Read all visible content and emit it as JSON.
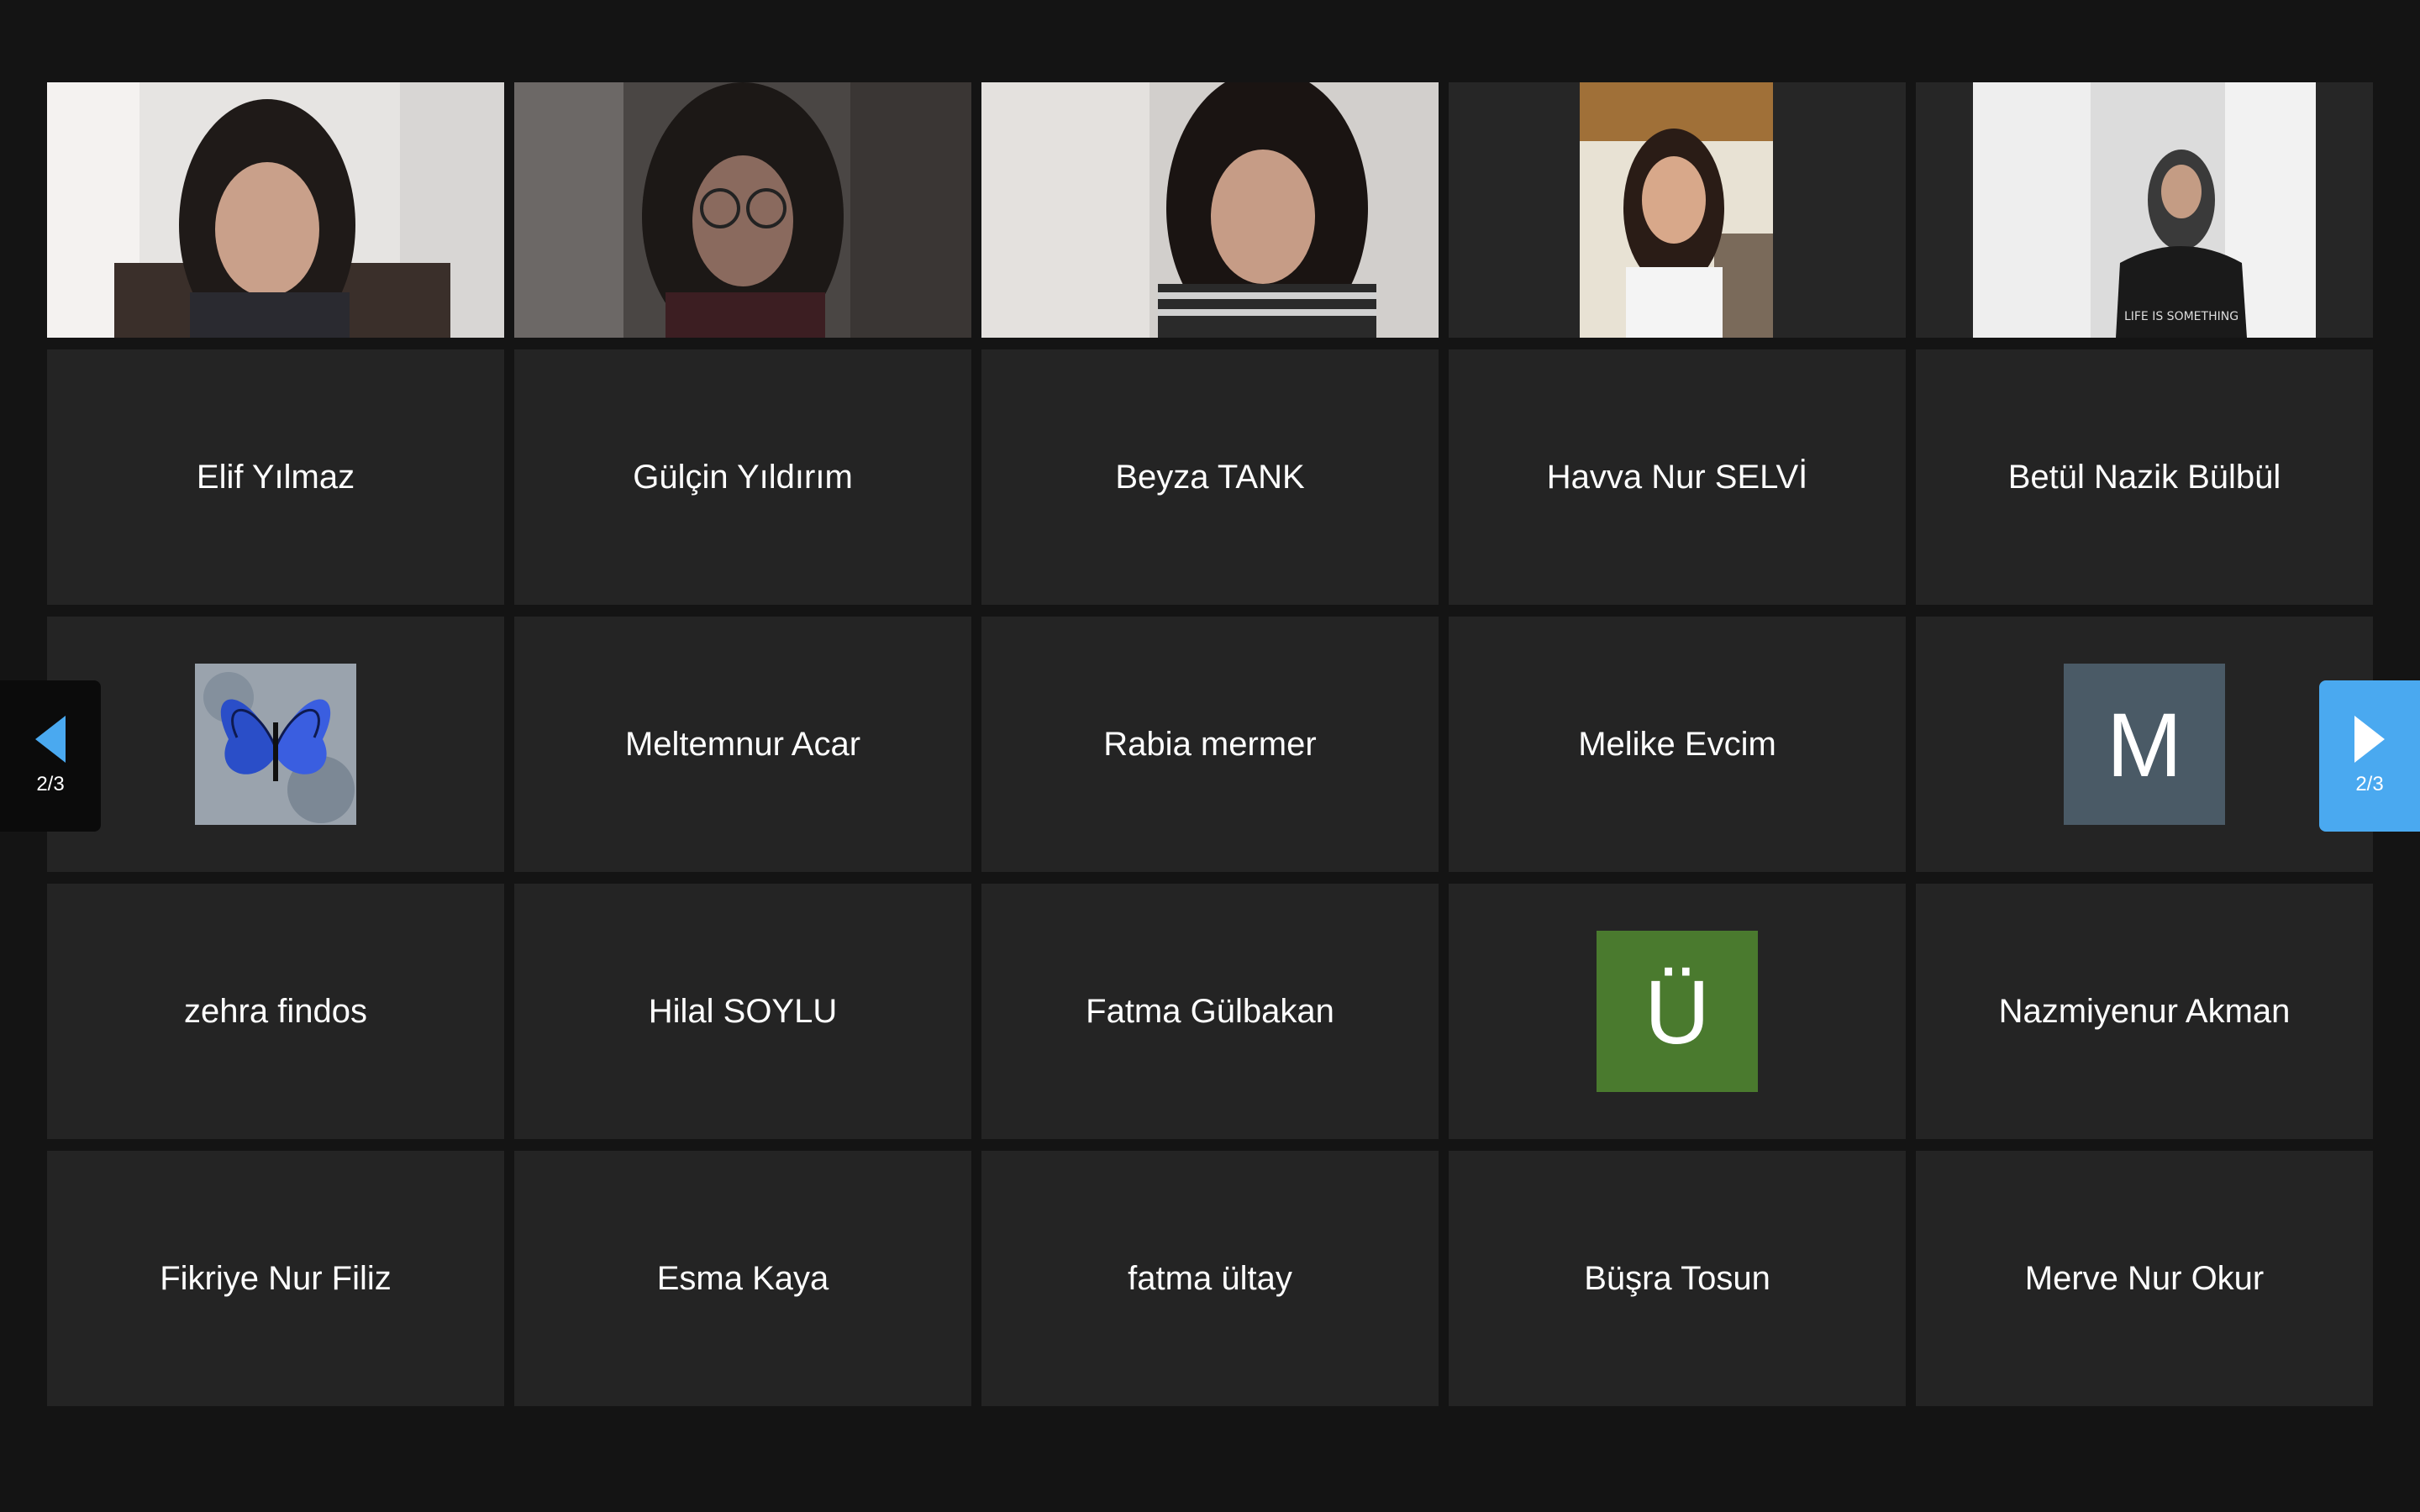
{
  "colors": {
    "background": "#141414",
    "tile": "#242424",
    "next_button": "#4aa9f0",
    "prev_arrow": "#4aa9f0",
    "avatar_m": "#4a5a66",
    "avatar_u": "#4a7a2e"
  },
  "pager": {
    "prev_label": "2/3",
    "next_label": "2/3",
    "prev_icon": "chevron-left-icon",
    "next_icon": "chevron-right-icon"
  },
  "tiles": {
    "video": [],
    "names": [
      "Elif Yılmaz",
      "Gülçin Yıldırım",
      "Beyza TANK",
      "Havva Nur SELVİ",
      "Betül Nazik Bülbül"
    ],
    "row3": {
      "avatar_butterfly_icon": "butterfly-profile-image",
      "meltemnur": "Meltemnur Acar",
      "rabia": "Rabia mermer",
      "melike": "Melike Evcim",
      "avatar_m_letter": "M"
    },
    "row4": {
      "zehra": "zehra findos",
      "hilal": "Hilal SOYLU",
      "fatma_g": "Fatma Gülbakan",
      "avatar_u_letter": "Ü",
      "nazmiyenur": "Nazmiyenur Akman"
    },
    "row5": {
      "fikriye": "Fikriye Nur Filiz",
      "esma": "Esma Kaya",
      "fatma_u": "fatma ültay",
      "busra": "Büşra Tosun",
      "merve": "Merve Nur Okur"
    }
  },
  "shirt_text": "LIFE IS SOMETHING"
}
